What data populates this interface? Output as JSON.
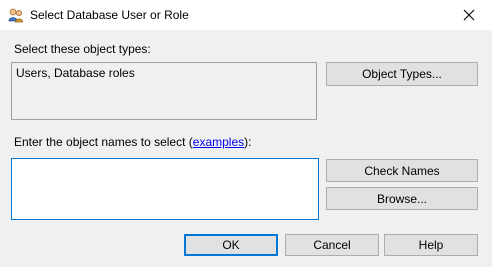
{
  "window": {
    "title": "Select Database User or Role",
    "icon": "users-roles-icon",
    "close_icon": "close-icon"
  },
  "object_types": {
    "label": "Select these object types:",
    "value": "Users, Database roles",
    "button_label": "Object Types..."
  },
  "object_names": {
    "label_prefix": "Enter the object names to select (",
    "link_text": "examples",
    "label_suffix": "):",
    "value": "",
    "check_names_label": "Check Names",
    "browse_label": "Browse..."
  },
  "footer": {
    "ok_label": "OK",
    "cancel_label": "Cancel",
    "help_label": "Help"
  },
  "colors": {
    "focus_border": "#0078d7",
    "link": "#0000ee"
  }
}
